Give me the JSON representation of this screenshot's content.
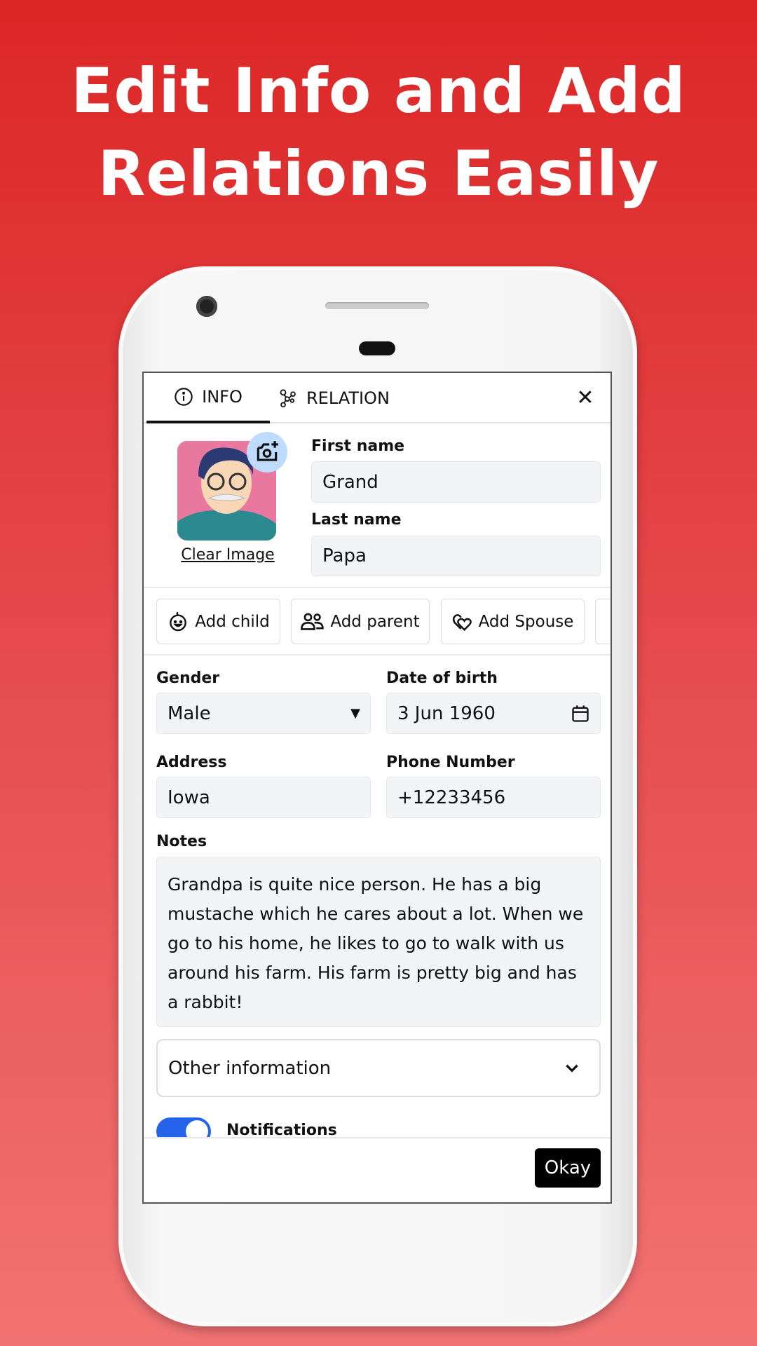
{
  "headline": {
    "line1": "Edit Info and Add",
    "line2": "Relations Easily"
  },
  "tabs": [
    {
      "label": "INFO",
      "icon": "info-circle-icon",
      "active": true
    },
    {
      "label": "RELATION",
      "icon": "relation-nodes-icon",
      "active": false
    }
  ],
  "profile": {
    "clear_image": "Clear Image",
    "first_name_label": "First name",
    "first_name": "Grand",
    "last_name_label": "Last name",
    "last_name": "Papa"
  },
  "relation_buttons": [
    {
      "label": "Add child",
      "icon": "baby-face-icon"
    },
    {
      "label": "Add parent",
      "icon": "users-icon"
    },
    {
      "label": "Add Spouse",
      "icon": "hearts-icon"
    }
  ],
  "form": {
    "gender_label": "Gender",
    "gender": "Male",
    "dob_label": "Date of birth",
    "dob": "3 Jun 1960",
    "address_label": "Address",
    "address": "Iowa",
    "phone_label": "Phone Number",
    "phone": "+12233456",
    "notes_label": "Notes",
    "notes": "Grandpa is quite nice person. He has a big mustache which he cares about a lot. When we go to his home, he likes to go to walk with us around his farm. His farm is pretty big and has a rabbit!",
    "other_info": "Other information",
    "notifications_label": "Notifications",
    "notifications_on": true
  },
  "footer": {
    "okay": "Okay"
  },
  "colors": {
    "background_top": "#dc2626",
    "background_bottom": "#f27373",
    "toggle": "#2563eb",
    "camera_badge": "#bfdbfe"
  }
}
